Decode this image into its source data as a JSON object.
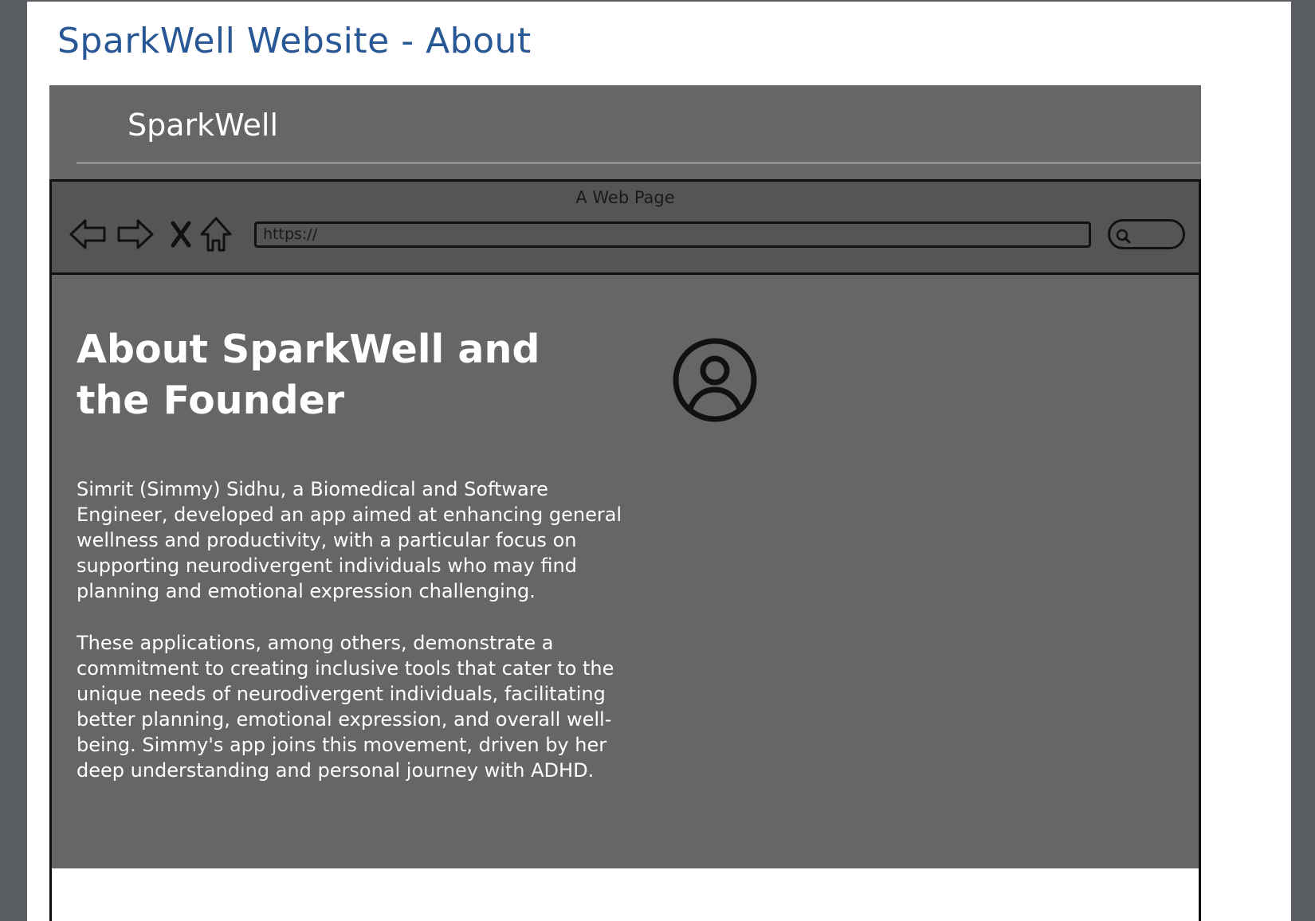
{
  "document": {
    "title": "SparkWell Website - About"
  },
  "site": {
    "brand": "SparkWell"
  },
  "browser": {
    "window_title": "A Web Page",
    "url": "https://",
    "icons": {
      "back": "back-arrow-icon",
      "forward": "forward-arrow-icon",
      "stop": "close-icon",
      "home": "home-icon",
      "search": "search-icon"
    }
  },
  "content": {
    "heading": "About SparkWell and the Founder",
    "paragraph_1": "Simrit (Simmy) Sidhu, a Biomedical and Software Engineer, developed an app aimed at enhancing general wellness and productivity, with a particular focus on supporting neurodivergent individuals who may find planning and emotional expression challenging.",
    "paragraph_2": "These applications, among others, demonstrate a commitment to creating inclusive tools that cater to the unique needs of neurodivergent individuals, facilitating better planning, emotional expression, and overall well-being. Simmy's app joins this movement, driven by her deep understanding and personal journey with ADHD.",
    "avatar_icon": "user-avatar-icon"
  },
  "colors": {
    "title": "#285795",
    "panel": "#666666",
    "chrome": "#555555",
    "text": "#ffffff",
    "outline": "#111111"
  }
}
